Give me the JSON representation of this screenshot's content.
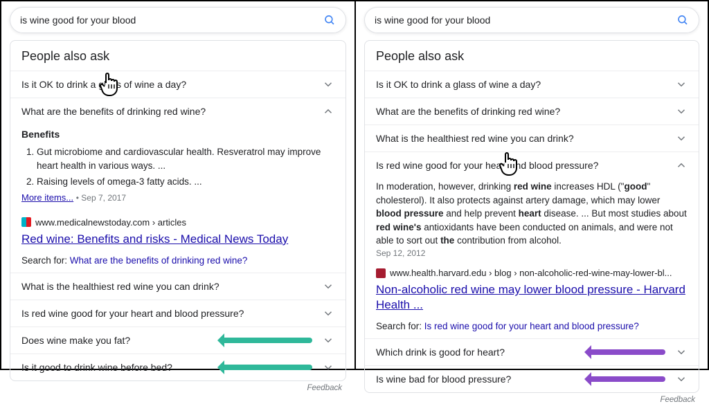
{
  "search_query": "is wine good for your blood",
  "paa_header": "People also ask",
  "feedback_label": "Feedback",
  "left": {
    "questions": [
      "Is it OK to drink a glass of wine a day?",
      "What are the benefits of drinking red wine?",
      "What is the healthiest red wine you can drink?",
      "Is red wine good for your heart and blood pressure?",
      "Does wine make you fat?",
      "Is it good to drink wine before bed?"
    ],
    "benefits_title": "Benefits",
    "benefits_list": [
      "Gut microbiome and cardiovascular health. Resveratrol may improve heart health in various ways. ...",
      "Raising levels of omega-3 fatty acids. ..."
    ],
    "more_label": "More items...",
    "more_date": "Sep 7, 2017",
    "source_path": "www.medicalnewstoday.com › articles",
    "result_title": "Red wine: Benefits and risks - Medical News Today",
    "search_for_prefix": "Search for: ",
    "search_for_link": "What are the benefits of drinking red wine?"
  },
  "right": {
    "questions": [
      "Is it OK to drink a glass of wine a day?",
      "What are the benefits of drinking red wine?",
      "What is the healthiest red wine you can drink?",
      "Is red wine good for your heart and blood pressure?",
      "Which drink is good for heart?",
      "Is wine bad for blood pressure?"
    ],
    "snippet_parts": {
      "p1": "In moderation, however, drinking ",
      "b1": "red wine",
      "p2": " increases HDL (\"",
      "b2": "good",
      "p3": "\" cholesterol). It also protects against artery damage, which may lower ",
      "b3": "blood pressure",
      "p4": " and help prevent ",
      "b4": "heart",
      "p5": " disease. ... But most studies about ",
      "b5": "red wine's",
      "p6": " antioxidants have been conducted on animals, and were not able to sort out ",
      "b6": "the",
      "p7": " contribution from alcohol."
    },
    "snippet_date": "Sep 12, 2012",
    "source_path": "www.health.harvard.edu › blog › non-alcoholic-red-wine-may-lower-bl...",
    "result_title": "Non-alcoholic red wine may lower blood pressure - Harvard Health ...",
    "search_for_prefix": "Search for: ",
    "search_for_link": "Is red wine good for your heart and blood pressure?"
  }
}
